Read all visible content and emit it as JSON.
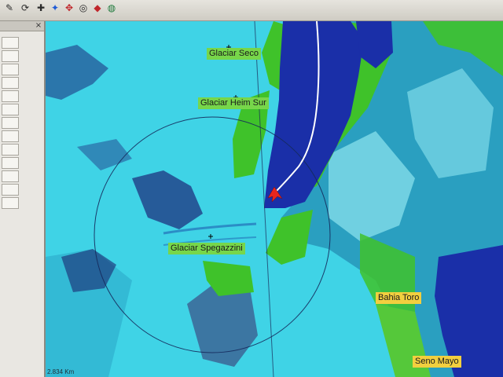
{
  "toolbar": {
    "icons": [
      "edit-icon",
      "refresh-icon",
      "add-icon",
      "palette-icon",
      "move-icon",
      "target-icon",
      "layers-icon",
      "globe-icon"
    ]
  },
  "map": {
    "labels": {
      "glaciar_seco": "Glaciar Seco",
      "glaciar_heim_sur": "Glaciar Heim Sur",
      "glaciar_spegazzini": "Glaciar Spegazzini",
      "bahia_toro": "Bahia Toro",
      "seno_mayo": "Seno Mayo"
    },
    "scale": "2.834 Km",
    "colors": {
      "water": "#1a2fa8",
      "ice": "#3fd3e6",
      "vegetation": "#3fc22a",
      "track": "#ffffff",
      "cursor": "#e8261e",
      "glacier_label_bg": "#77d64a",
      "bay_label_bg": "#f2cf3f"
    }
  }
}
